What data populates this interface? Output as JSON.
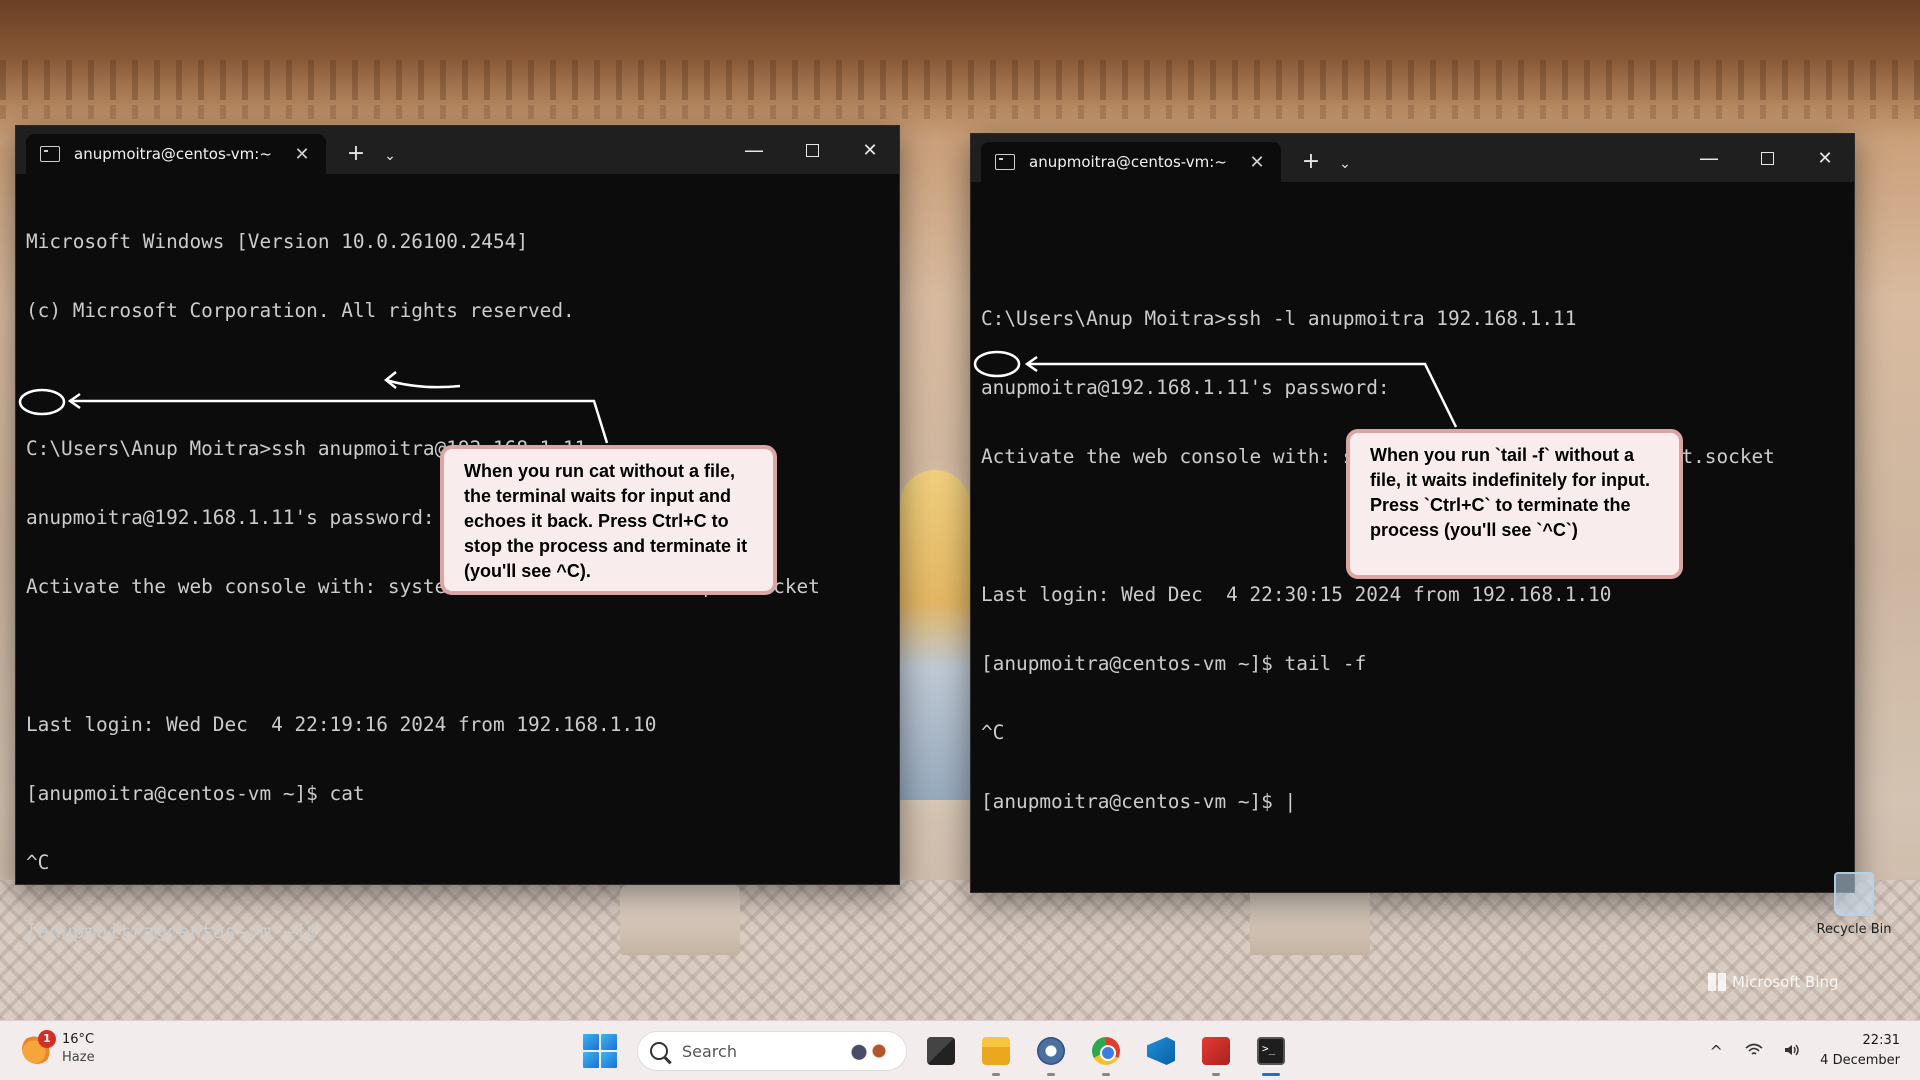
{
  "wallpaper": {
    "recycle_bin_label": "Recycle Bin",
    "watermark": "Microsoft Bing"
  },
  "terminal_left": {
    "tab_title": "anupmoitra@centos-vm:~",
    "lines": [
      "Microsoft Windows [Version 10.0.26100.2454]",
      "(c) Microsoft Corporation. All rights reserved.",
      "",
      "C:\\Users\\Anup Moitra>ssh anupmoitra@192.168.1.11",
      "anupmoitra@192.168.1.11's password:",
      "Activate the web console with: systemctl enable --now cockpit.socket",
      "",
      "Last login: Wed Dec  4 22:19:16 2024 from 192.168.1.10",
      "[anupmoitra@centos-vm ~]$ cat",
      "^C",
      "[anupmoitra@centos-vm ~]$"
    ],
    "callout": "When you run cat without a file, the terminal waits for input and echoes it back. Press Ctrl+C to stop the process and terminate it (you'll see ^C)."
  },
  "terminal_right": {
    "tab_title": "anupmoitra@centos-vm:~",
    "lines": [
      "",
      "C:\\Users\\Anup Moitra>ssh -l anupmoitra 192.168.1.11",
      "anupmoitra@192.168.1.11's password:",
      "Activate the web console with: systemctl enable --now cockpit.socket",
      "",
      "Last login: Wed Dec  4 22:30:15 2024 from 192.168.1.10",
      "[anupmoitra@centos-vm ~]$ tail -f",
      "^C",
      "[anupmoitra@centos-vm ~]$ |"
    ],
    "callout": "When you run `tail -f` without a file, it waits indefinitely for input. Press `Ctrl+C` to terminate the process (you'll see `^C`)"
  },
  "window_controls": {
    "add_tab": "+",
    "dropdown": "⌄",
    "minimize": "—",
    "close_tab": "✕",
    "close": "✕"
  },
  "taskbar": {
    "weather_temp": "16°C",
    "weather_condition": "Haze",
    "weather_badge": "1",
    "search_placeholder": "Search",
    "apps": [
      "task-view-icon",
      "file-explorer-icon",
      "settings-icon",
      "chrome-icon",
      "vscode-icon",
      "app-icon",
      "terminal-icon"
    ],
    "tray_chevron": "^",
    "time": "22:31",
    "date": "4 December"
  },
  "colors": {
    "terminal_bg": "#0c0c0c",
    "terminal_text": "#cccccc",
    "callout_bg": "#f9ecec",
    "callout_border": "#d9a5a5",
    "taskbar_bg": "#f2ecec"
  }
}
